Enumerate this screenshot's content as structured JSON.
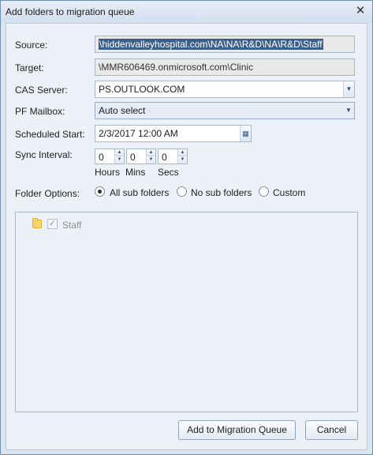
{
  "window": {
    "title": "Add folders to migration queue",
    "close_glyph": "✕"
  },
  "form": {
    "source": {
      "label": "Source:",
      "value": "\\hiddenvalleyhospital.com\\NA\\NA\\R&D\\NA\\R&D\\Staff"
    },
    "target": {
      "label": "Target:",
      "value": "\\MMR606469.onmicrosoft.com\\Clinic"
    },
    "cas_server": {
      "label": "CAS Server:",
      "value": "PS.OUTLOOK.COM"
    },
    "pf_mailbox": {
      "label": "PF Mailbox:",
      "value": "Auto select"
    },
    "scheduled_start": {
      "label": "Scheduled Start:",
      "value": "2/3/2017 12:00 AM"
    },
    "sync_interval": {
      "label": "Sync Interval:",
      "hours": {
        "value": "0",
        "unit": "Hours"
      },
      "mins": {
        "value": "0",
        "unit": "Mins"
      },
      "secs": {
        "value": "0",
        "unit": "Secs"
      }
    },
    "folder_options": {
      "label": "Folder Options:",
      "options": [
        "All sub folders",
        "No sub folders",
        "Custom"
      ],
      "selected": "All sub folders"
    }
  },
  "tree": {
    "items": [
      {
        "label": "Staff",
        "checked": true
      }
    ]
  },
  "buttons": {
    "add": "Add to Migration Queue",
    "cancel": "Cancel"
  }
}
